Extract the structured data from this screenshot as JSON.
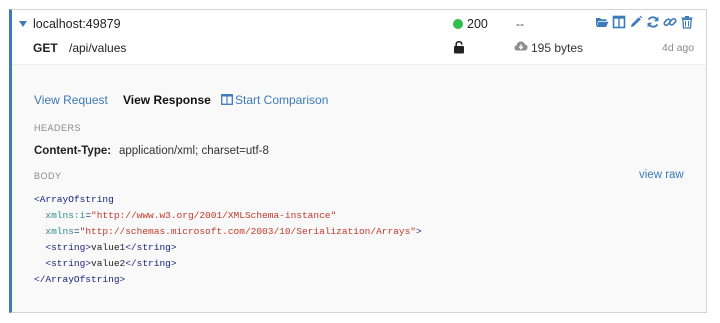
{
  "request": {
    "host": "localhost:49879",
    "method": "GET",
    "path": "/api/values",
    "status_code": "200",
    "duration": "--",
    "size": "195 bytes",
    "age": "4d ago"
  },
  "icons": {
    "toggle": "caret-down-icon",
    "status": "status-dot-icon",
    "lock": "unlock-icon",
    "cloud": "cloud-download-icon",
    "toolbar": [
      "folder-open-icon",
      "columns-icon",
      "pencil-icon",
      "refresh-icon",
      "link-icon",
      "trash-icon"
    ],
    "compare": "columns-icon"
  },
  "tabs": {
    "view_request": "View Request",
    "view_response": "View Response",
    "start_comparison": "Start Comparison"
  },
  "sections": {
    "headers": "HEADERS",
    "body": "BODY",
    "view_raw": "view raw"
  },
  "response_header": {
    "key": "Content-Type:",
    "value": "application/xml; charset=utf-8"
  },
  "xml": {
    "l1_tag": "<ArrayOfstring",
    "l2_attr": "xmlns:i",
    "l2_eq": "=",
    "l2_val": "\"http://www.w3.org/2001/XMLSchema-instance\"",
    "l3_attr": "xmlns",
    "l3_eq": "=",
    "l3_val": "\"http://schemas.microsoft.com/2003/10/Serialization/Arrays\"",
    "l3_close": ">",
    "l4_open": "<string>",
    "l4_text": "value1",
    "l4_close": "</string>",
    "l5_open": "<string>",
    "l5_text": "value2",
    "l5_close": "</string>",
    "l6_tag": "</ArrayOfstring>"
  },
  "colors": {
    "accent": "#3d7ab8",
    "status_ok": "#2ebf4f",
    "xml_tag": "#1a237e",
    "xml_attr": "#2e8b8b",
    "xml_value": "#c0392b"
  }
}
